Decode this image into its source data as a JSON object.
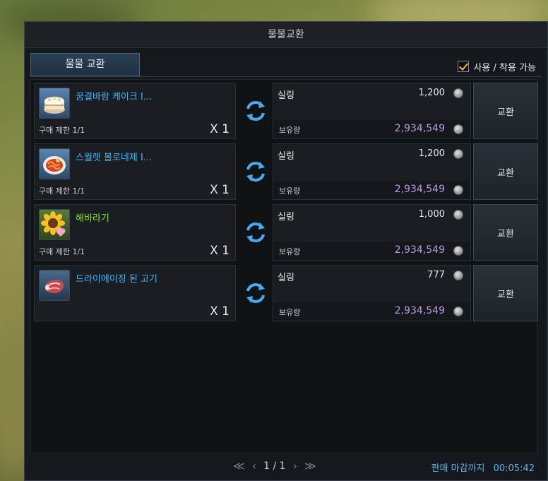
{
  "window": {
    "title": "물물교환"
  },
  "tab": {
    "label": "물물 교환"
  },
  "filter": {
    "label": "사용 / 착용 가능",
    "checked": true
  },
  "rows": [
    {
      "name": "꿈결바람 케이크 I...",
      "name_color": "#4fb3f0",
      "icon": "cake-icon",
      "limit": "구매 제한 1/1",
      "qty": "X 1",
      "currency": "실링",
      "cost": "1,200",
      "hold_label": "보유량",
      "hold": "2,934,549",
      "button": "교환"
    },
    {
      "name": "스월렛 볼로네제 I...",
      "name_color": "#4fb3f0",
      "icon": "pasta-icon",
      "limit": "구매 제한 1/1",
      "qty": "X 1",
      "currency": "실링",
      "cost": "1,200",
      "hold_label": "보유량",
      "hold": "2,934,549",
      "button": "교환"
    },
    {
      "name": "해바라기",
      "name_color": "#8fe04a",
      "icon": "sunflower-icon",
      "limit": "구매 제한 1/1",
      "qty": "X 1",
      "currency": "실링",
      "cost": "1,000",
      "hold_label": "보유량",
      "hold": "2,934,549",
      "button": "교환"
    },
    {
      "name": "드라이에이징 된 고기",
      "name_color": "#4fb3f0",
      "icon": "meat-icon",
      "limit": "",
      "qty": "X 1",
      "currency": "실링",
      "cost": "777",
      "hold_label": "보유량",
      "hold": "2,934,549",
      "button": "교환"
    }
  ],
  "pager": {
    "first": "≪",
    "prev": "‹",
    "page": "1 / 1",
    "next": "›",
    "last": "≫"
  },
  "deadline": {
    "label": "판매 마감까지",
    "time": "00:05:42"
  },
  "colors": {
    "accent": "#5fb2e8",
    "hold": "#b99be0"
  }
}
